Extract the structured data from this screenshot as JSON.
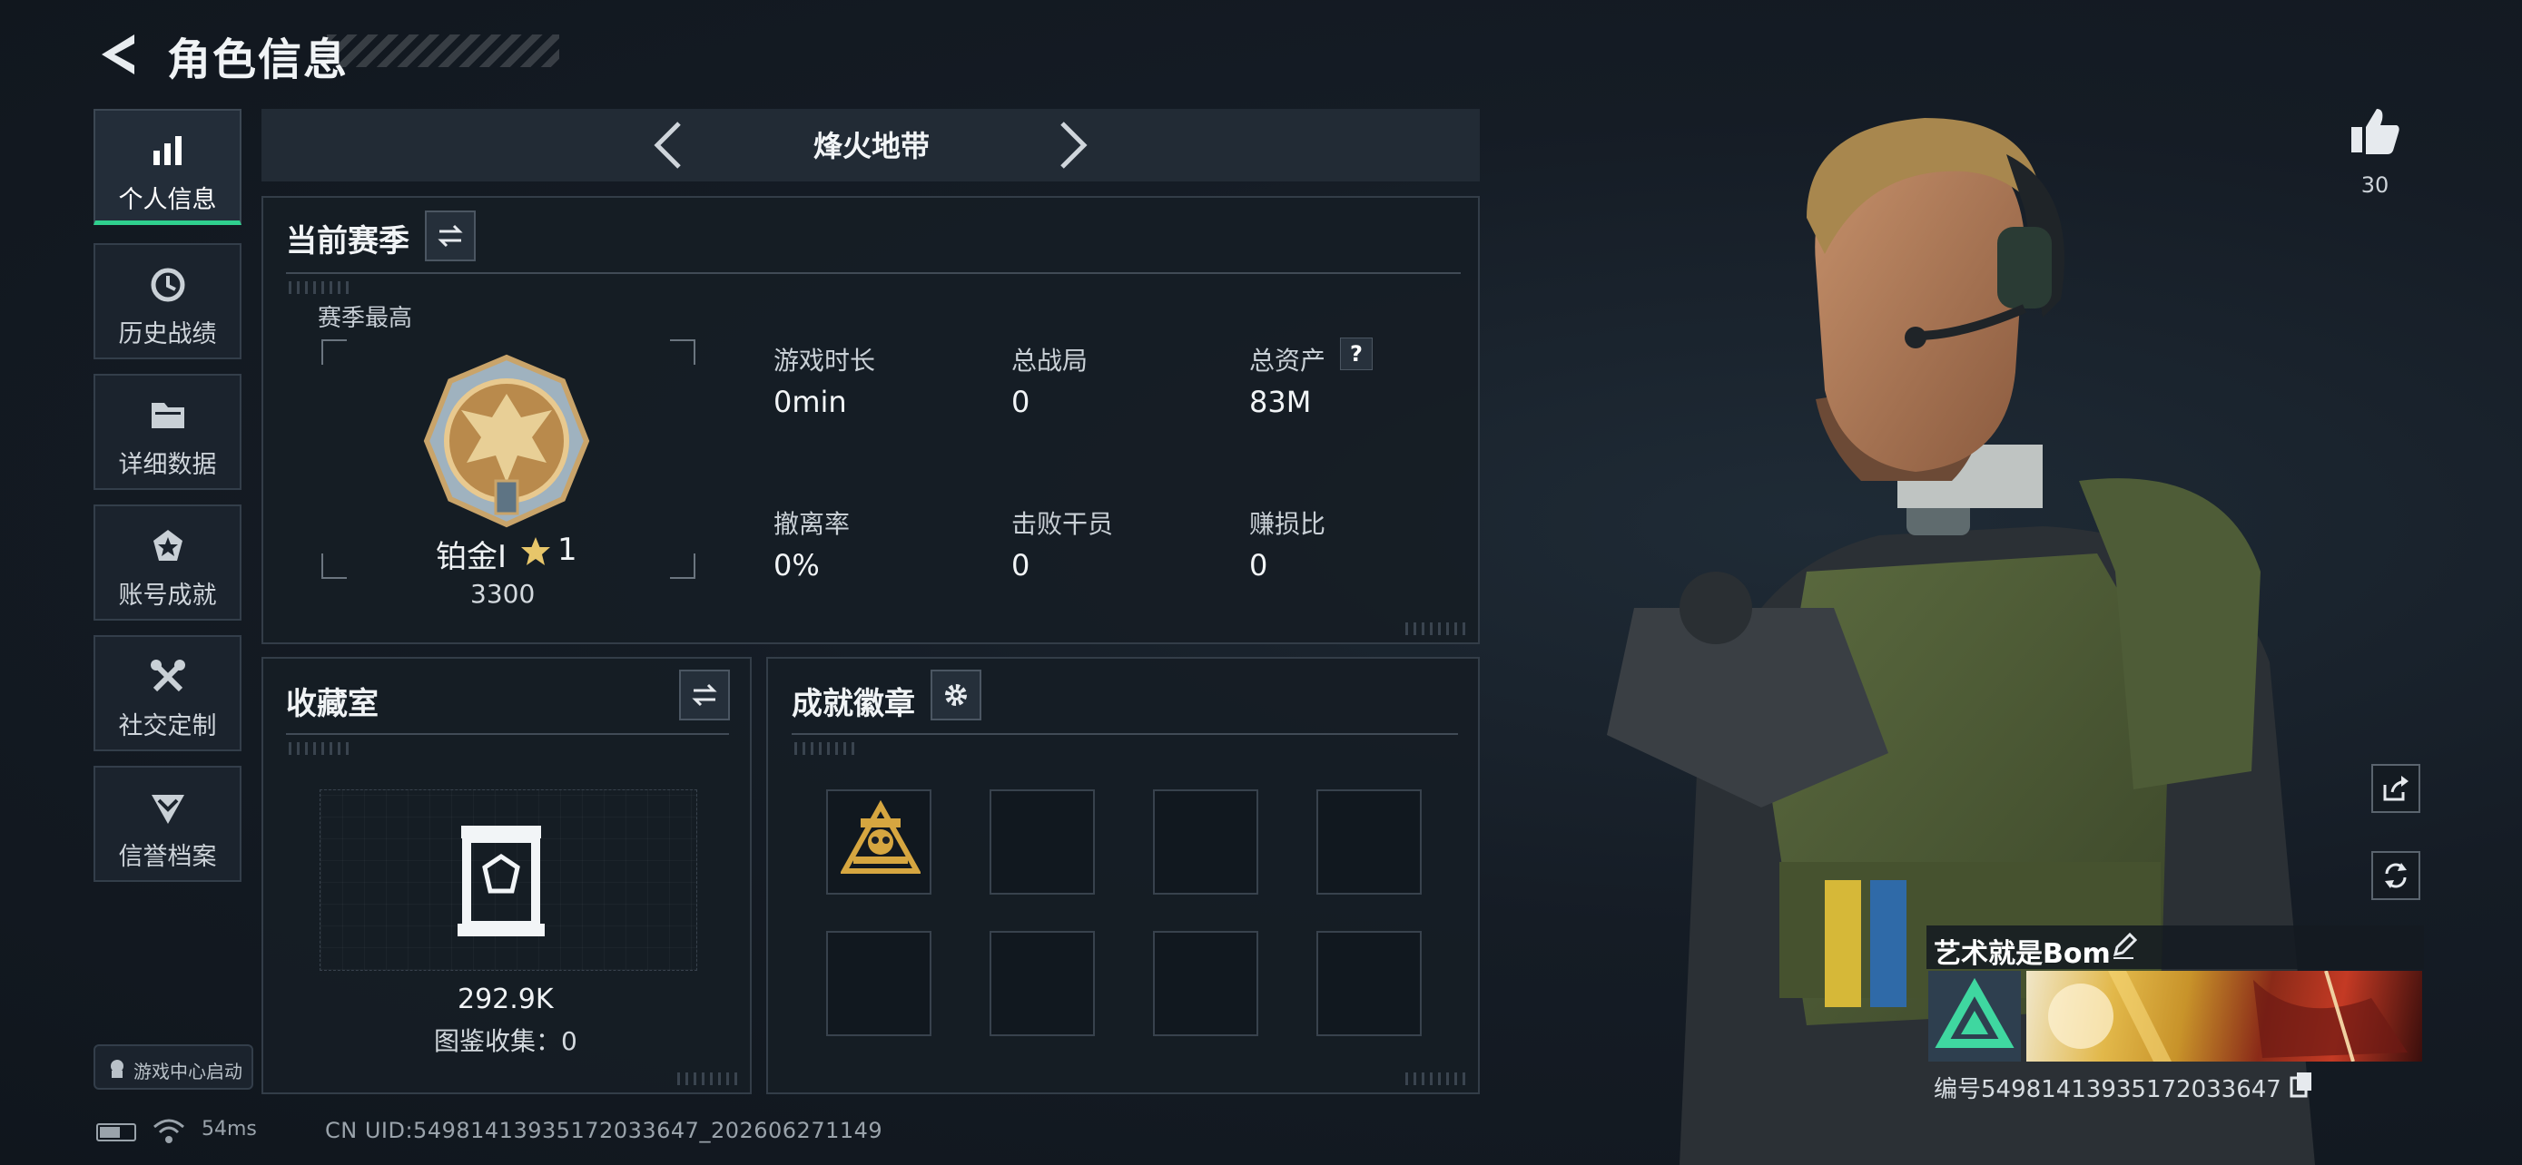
{
  "header": {
    "title": "角色信息"
  },
  "sidebar": {
    "items": [
      {
        "label": "个人信息",
        "icon": "bar-chart-icon",
        "active": true
      },
      {
        "label": "历史战绩",
        "icon": "history-clock-icon"
      },
      {
        "label": "详细数据",
        "icon": "folder-icon"
      },
      {
        "label": "账号成就",
        "icon": "medal-icon"
      },
      {
        "label": "社交定制",
        "icon": "tools-icon"
      },
      {
        "label": "信誉档案",
        "icon": "shield-chevron-icon"
      }
    ],
    "game_center_label": "游戏中心启动"
  },
  "status_bar": {
    "ping": "54ms",
    "uid": "CN UID:5498141393517203364​7_202606271149"
  },
  "mode_selector": {
    "title": "烽火地带"
  },
  "season_panel": {
    "title": "当前赛季",
    "best_label": "赛季最高",
    "rank_name": "铂金I",
    "rank_level": "1",
    "rank_score": "3300",
    "stats": [
      {
        "label": "游戏时长",
        "value": "0min"
      },
      {
        "label": "总战局",
        "value": "0"
      },
      {
        "label": "总资产",
        "value": "83M"
      },
      {
        "label": "撤离率",
        "value": "0%"
      },
      {
        "label": "击败干员",
        "value": "0"
      },
      {
        "label": "赚损比",
        "value": "0"
      }
    ],
    "help_glyph": "?"
  },
  "collection_panel": {
    "title": "收藏室",
    "value": "292.9K",
    "count_label": "图鉴收集：",
    "count_value": "0"
  },
  "badges_panel": {
    "title": "成就徽章",
    "slots": 8,
    "filled": 1
  },
  "profile": {
    "likes": "30",
    "player_name": "艺术就是Bom",
    "id_text": "编号5498141393517203364​7"
  },
  "colors": {
    "accent": "#2fd08e",
    "panel_border": "#333d48",
    "background": "#151c25"
  }
}
